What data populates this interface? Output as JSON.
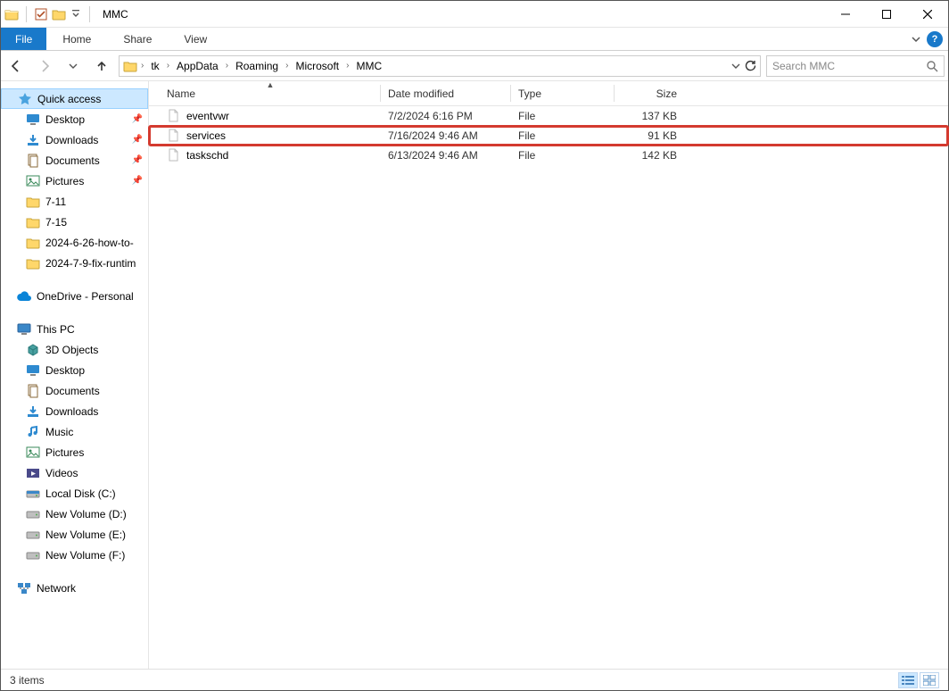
{
  "window": {
    "title": "MMC"
  },
  "ribbon": {
    "file": "File",
    "tabs": [
      "Home",
      "Share",
      "View"
    ]
  },
  "breadcrumb": [
    "tk",
    "AppData",
    "Roaming",
    "Microsoft",
    "MMC"
  ],
  "search": {
    "placeholder": "Search MMC"
  },
  "nav": {
    "quick_access": "Quick access",
    "pinned": [
      {
        "label": "Desktop",
        "icon": "desktop"
      },
      {
        "label": "Downloads",
        "icon": "downloads"
      },
      {
        "label": "Documents",
        "icon": "documents"
      },
      {
        "label": "Pictures",
        "icon": "pictures"
      }
    ],
    "recent": [
      "7-11",
      "7-15",
      "2024-6-26-how-to-",
      "2024-7-9-fix-runtim"
    ],
    "onedrive": "OneDrive - Personal",
    "this_pc": "This PC",
    "this_pc_items": [
      {
        "label": "3D Objects",
        "icon": "3d"
      },
      {
        "label": "Desktop",
        "icon": "desktop"
      },
      {
        "label": "Documents",
        "icon": "documents"
      },
      {
        "label": "Downloads",
        "icon": "downloads"
      },
      {
        "label": "Music",
        "icon": "music"
      },
      {
        "label": "Pictures",
        "icon": "pictures"
      },
      {
        "label": "Videos",
        "icon": "videos"
      },
      {
        "label": "Local Disk (C:)",
        "icon": "drive-c"
      },
      {
        "label": "New Volume (D:)",
        "icon": "drive"
      },
      {
        "label": "New Volume (E:)",
        "icon": "drive"
      },
      {
        "label": "New Volume (F:)",
        "icon": "drive"
      }
    ],
    "network": "Network"
  },
  "columns": {
    "name": "Name",
    "date": "Date modified",
    "type": "Type",
    "size": "Size"
  },
  "files": [
    {
      "name": "eventvwr",
      "date": "7/2/2024 6:16 PM",
      "type": "File",
      "size": "137 KB",
      "hl": false
    },
    {
      "name": "services",
      "date": "7/16/2024 9:46 AM",
      "type": "File",
      "size": "91 KB",
      "hl": true
    },
    {
      "name": "taskschd",
      "date": "6/13/2024 9:46 AM",
      "type": "File",
      "size": "142 KB",
      "hl": false
    }
  ],
  "status": {
    "text": "3 items"
  }
}
